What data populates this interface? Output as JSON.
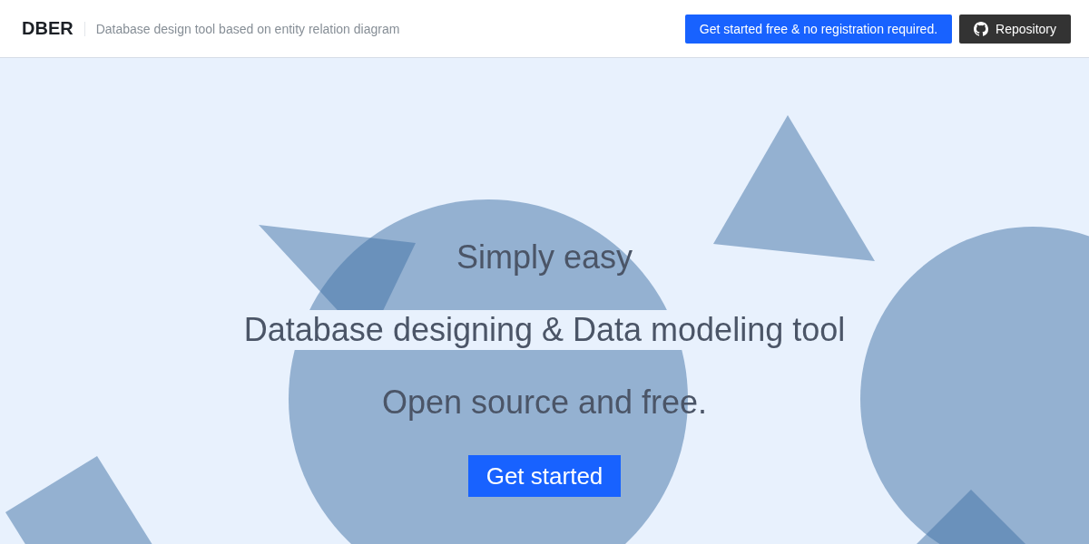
{
  "header": {
    "logo": "DBER",
    "tagline": "Database design tool based on entity relation diagram",
    "buttons": [
      {
        "label": "Get started free & no registration required.",
        "kind": "primary"
      },
      {
        "label": "Repository",
        "kind": "repository"
      }
    ]
  },
  "hero": {
    "lines": [
      "Simply easy",
      "Database designing & Data modeling tool",
      "Open source and free."
    ],
    "button": "Get started"
  }
}
